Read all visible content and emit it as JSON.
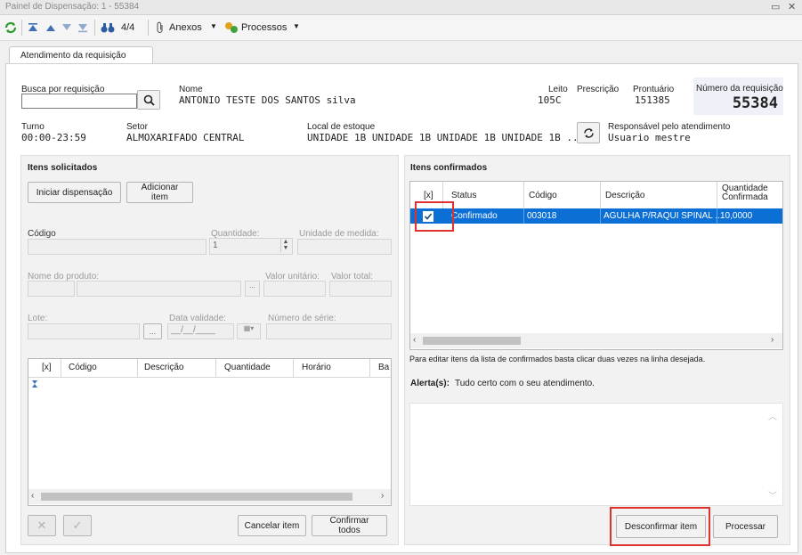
{
  "window": {
    "title": "Painel de Dispensação: 1 - 55384",
    "min_glyph": "▭",
    "close_glyph": "✕"
  },
  "toolbar": {
    "record_counter": "4/4",
    "anexos_label": "Anexos",
    "processos_label": "Processos"
  },
  "tabs": [
    {
      "label": "Atendimento da requisição"
    }
  ],
  "header": {
    "busca_label": "Busca por requisição",
    "busca_value": "",
    "nome_label": "Nome",
    "nome_value": "ANTONIO TESTE DOS SANTOS silva",
    "leito_label": "Leito",
    "leito_value": "105C",
    "prescricao_label": "Prescrição",
    "prontuario_label": "Prontuário",
    "prontuario_value": "151385",
    "numero_label": "Número da requisição",
    "numero_value": "55384",
    "turno_label": "Turno",
    "turno_value": "00:00-23:59",
    "setor_label": "Setor",
    "setor_value": "ALMOXARIFADO CENTRAL",
    "local_label": "Local de estoque",
    "local_value": "UNIDADE 1B UNIDADE 1B UNIDADE 1B UNIDADE 1B ...",
    "responsavel_label": "Responsável pelo atendimento",
    "responsavel_value": "Usuario mestre"
  },
  "left": {
    "title": "Itens solicitados",
    "iniciar_label": "Iniciar dispensação",
    "adicionar_label": "Adicionar item",
    "codigo_label": "Código",
    "quantidade_label": "Quantidade:",
    "quantidade_value": "1",
    "unidade_label": "Unidade de medida:",
    "nome_produto_label": "Nome do produto:",
    "valor_unitario_label": "Valor unitário:",
    "valor_total_label": "Valor total:",
    "lote_label": "Lote:",
    "data_validade_label": "Data validade:",
    "data_validade_value": "__/__/____",
    "numero_serie_label": "Número de série:",
    "ellipsis": "...",
    "columns": [
      "[x]",
      "Código",
      "Descrição",
      "Quantidade",
      "Horário",
      "Ba"
    ],
    "cancelar_label": "Cancelar item",
    "confirmar_todos_label": "Confirmar todos"
  },
  "right": {
    "title": "Itens confirmados",
    "columns": [
      "[x]",
      "Status",
      "Código",
      "Descrição",
      "Quantidade Confirmada"
    ],
    "rows": [
      {
        "checked": true,
        "status": "Confirmado",
        "codigo": "003018",
        "descricao": "AGULHA P/RAQUI SPINAL ...",
        "quantidade": "10,0000"
      }
    ],
    "hint": "Para editar itens da lista de confirmados basta clicar duas vezes na linha desejada.",
    "alertas_label": "Alerta(s):",
    "alertas_value": "Tudo certo com o seu atendimento.",
    "desconfirmar_label": "Desconfirmar item",
    "processar_label": "Processar"
  },
  "colors": {
    "selection": "#0b6fd6",
    "highlight": "#e0312f",
    "number_box": "#eef2f8"
  }
}
